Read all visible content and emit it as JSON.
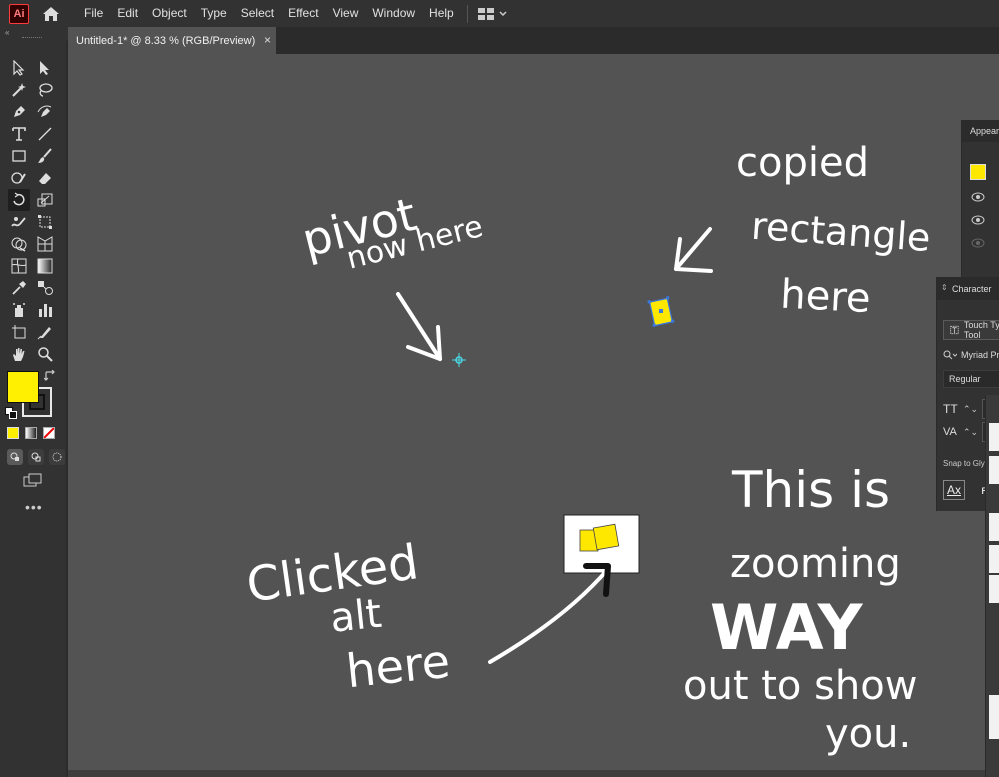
{
  "app": {
    "logo": "Ai"
  },
  "menu": {
    "items": [
      "File",
      "Edit",
      "Object",
      "Type",
      "Select",
      "Effect",
      "View",
      "Window",
      "Help"
    ]
  },
  "document": {
    "tab_title": "Untitled-1* @ 8.33 % (RGB/Preview)",
    "close_label": "×"
  },
  "toolbar": {
    "tools": [
      "selection-tool",
      "direct-selection-tool",
      "magic-wand-tool",
      "lasso-tool",
      "pen-tool",
      "curvature-tool",
      "type-tool",
      "line-tool",
      "rectangle-tool",
      "paintbrush-tool",
      "shaper-tool",
      "eraser-tool",
      "rotate-tool",
      "scale-tool",
      "warp-tool",
      "free-transform-tool",
      "shape-builder-tool",
      "perspective-grid-tool",
      "mesh-tool",
      "gradient-tool",
      "eyedropper-tool",
      "blend-tool",
      "symbol-sprayer-tool",
      "column-graph-tool",
      "artboard-tool",
      "slice-tool",
      "hand-tool",
      "zoom-tool"
    ],
    "active_tool": "rotate-tool",
    "fill_color": "#FFEF00",
    "stroke_color": "#000000",
    "more_label": "•••"
  },
  "annotations": {
    "pivot_line1": "pivot",
    "pivot_line2": "now here",
    "copied_line1": "copied",
    "copied_line2": "rectangle",
    "copied_line3": "here",
    "clicked_line1": "Clicked",
    "clicked_line2": "alt",
    "clicked_line3": "here",
    "zoom_line1": "This is",
    "zoom_line2": "zooming",
    "zoom_line3": "WAY",
    "zoom_line4": "out to show",
    "zoom_line5": "you."
  },
  "appearance_panel": {
    "title": "Appearance",
    "swatch_color": "#FFE800"
  },
  "character_panel": {
    "title": "Character",
    "touch_type_label": "Touch Type Tool",
    "font_family": "Myriad Pro",
    "font_style": "Regular",
    "snap_label": "Snap to Glyph",
    "size_icon": "TT",
    "tracking_icon": "VA"
  }
}
